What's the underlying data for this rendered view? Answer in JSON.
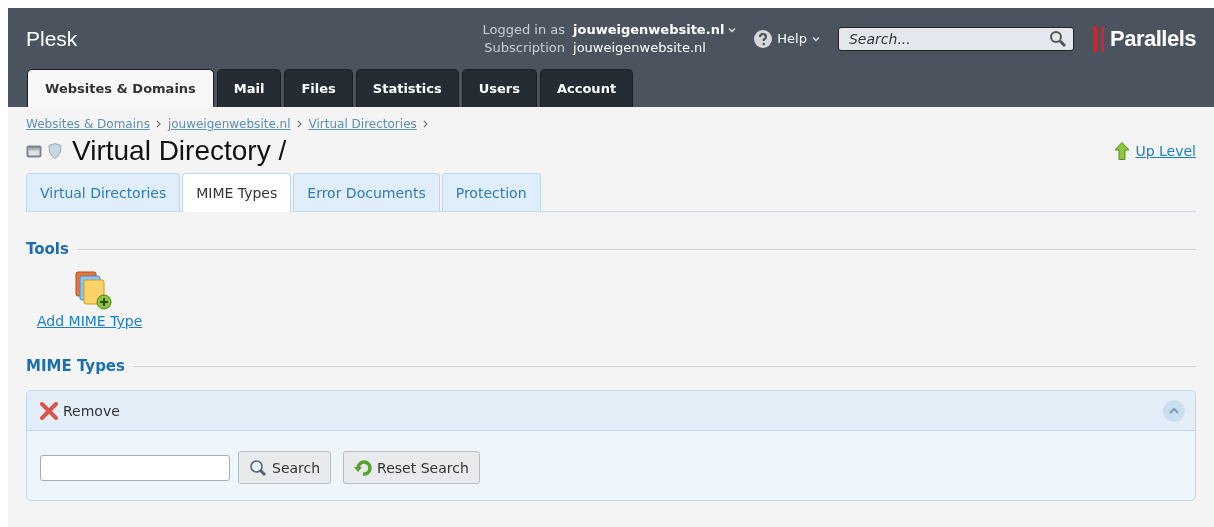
{
  "header": {
    "brand": "Plesk",
    "logged_in_label": "Logged in as",
    "logged_in_user": "jouweigenwebsite.nl",
    "subscription_label": "Subscription",
    "subscription_value": "jouweigenwebsite.nl",
    "help": "Help",
    "search": {
      "placeholder": "Search..."
    },
    "vendor_logo": "Parallels"
  },
  "main_tabs": [
    {
      "label": "Websites & Domains",
      "selected": true
    },
    {
      "label": "Mail",
      "selected": false
    },
    {
      "label": "Files",
      "selected": false
    },
    {
      "label": "Statistics",
      "selected": false
    },
    {
      "label": "Users",
      "selected": false
    },
    {
      "label": "Account",
      "selected": false
    }
  ],
  "breadcrumbs": [
    "Websites & Domains",
    "jouweigenwebsite.nl",
    "Virtual Directories"
  ],
  "page_title": "Virtual Directory /",
  "up_level": "Up Level",
  "sub_tabs": [
    {
      "label": "Virtual Directories",
      "selected": false
    },
    {
      "label": "MIME Types",
      "selected": true
    },
    {
      "label": "Error Documents",
      "selected": false
    },
    {
      "label": "Protection",
      "selected": false
    }
  ],
  "tools": {
    "title": "Tools",
    "items": [
      "Add MIME Type"
    ]
  },
  "list": {
    "title": "MIME Types",
    "actions": [
      "Remove"
    ],
    "search_button": "Search",
    "reset_button": "Reset Search"
  }
}
